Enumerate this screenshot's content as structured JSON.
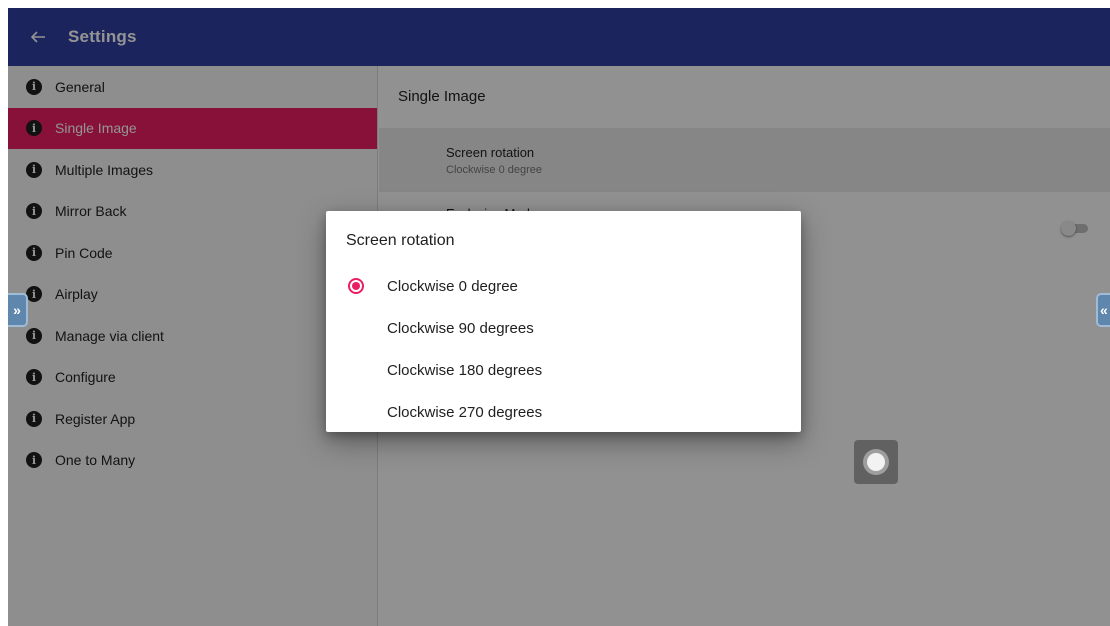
{
  "appbar": {
    "back_icon": "arrow-left-icon",
    "title": "Settings",
    "background_color": "#303f9f"
  },
  "sidebar": {
    "active_color": "#e91e63",
    "items": [
      {
        "label": "General",
        "icon": "info-icon"
      },
      {
        "label": "Single Image",
        "icon": "info-icon",
        "active": true
      },
      {
        "label": "Multiple Images",
        "icon": "info-icon"
      },
      {
        "label": "Mirror Back",
        "icon": "info-icon"
      },
      {
        "label": "Pin Code",
        "icon": "info-icon"
      },
      {
        "label": "Airplay",
        "icon": "info-icon"
      },
      {
        "label": "Manage via client",
        "icon": "info-icon"
      },
      {
        "label": "Configure",
        "icon": "info-icon"
      },
      {
        "label": "Register App",
        "icon": "info-icon"
      },
      {
        "label": "One to Many",
        "icon": "info-icon"
      }
    ]
  },
  "main": {
    "header": "Single Image",
    "screen_rotation": {
      "title": "Screen rotation",
      "summary": "Clockwise 0 degree"
    },
    "exclusive_mode": {
      "title": "Exclusive Mode",
      "enabled": false
    }
  },
  "edge_handles": {
    "left_icon": "double-chevron-right-icon",
    "left_glyph": "»",
    "right_icon": "double-chevron-left-icon",
    "right_glyph": "«"
  },
  "assistive_touch": {
    "icon": "floating-assist-button-icon"
  },
  "dialog": {
    "title": "Screen rotation",
    "selected_index": 0,
    "options": [
      "Clockwise 0 degree",
      "Clockwise 90 degrees",
      "Clockwise 180 degrees",
      "Clockwise 270 degrees"
    ]
  }
}
